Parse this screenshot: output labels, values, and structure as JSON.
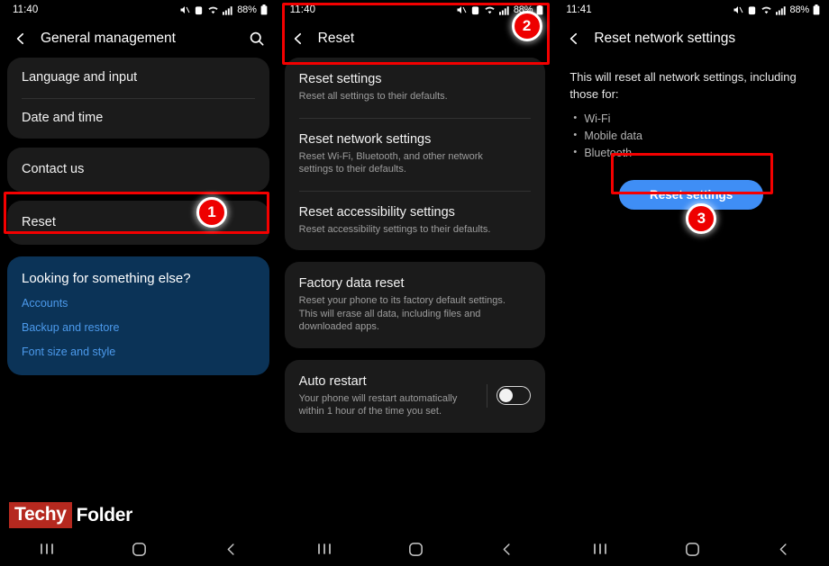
{
  "panels": [
    {
      "status": {
        "time": "11:40",
        "battery": "88%",
        "icons": [
          "mute-icon",
          "alarm-icon",
          "wifi-icon",
          "signal-icon",
          "battery-icon"
        ]
      },
      "appbar": {
        "title": "General management",
        "back": "back-icon",
        "search": "search-icon"
      },
      "cards": [
        {
          "rows": [
            {
              "title": "Language and input"
            },
            {
              "title": "Date and time"
            }
          ]
        },
        {
          "rows": [
            {
              "title": "Contact us"
            }
          ]
        },
        {
          "rows": [
            {
              "title": "Reset"
            }
          ]
        }
      ],
      "promo": {
        "title": "Looking for something else?",
        "links": [
          "Accounts",
          "Backup and restore",
          "Font size and style"
        ]
      },
      "badge": "1"
    },
    {
      "status": {
        "time": "11:40",
        "battery": "88%"
      },
      "appbar": {
        "title": "Reset",
        "back": "back-icon"
      },
      "cards": [
        {
          "rows": [
            {
              "title": "Reset settings",
              "sub": "Reset all settings to their defaults."
            },
            {
              "title": "Reset network settings",
              "sub": "Reset Wi-Fi, Bluetooth, and other network settings to their defaults."
            },
            {
              "title": "Reset accessibility settings",
              "sub": "Reset accessibility settings to their defaults."
            }
          ]
        },
        {
          "rows": [
            {
              "title": "Factory data reset",
              "sub": "Reset your phone to its factory default settings. This will erase all data, including files and downloaded apps."
            }
          ]
        },
        {
          "rows": [
            {
              "title": "Auto restart",
              "sub": "Your phone will restart automatically within 1 hour of the time you set.",
              "toggle": "off"
            }
          ]
        }
      ],
      "badge": "2"
    },
    {
      "status": {
        "time": "11:41",
        "battery": "88%"
      },
      "appbar": {
        "title": "Reset network settings",
        "back": "back-icon"
      },
      "body": {
        "description": "This will reset all network settings, including those for:",
        "bullets": [
          "Wi-Fi",
          "Mobile data",
          "Bluetooth"
        ],
        "button": "Reset settings"
      },
      "badge": "3"
    }
  ],
  "watermark": {
    "first": "Techy",
    "second": "Folder"
  },
  "navbar": {
    "recents": "recents-icon",
    "home": "home-icon",
    "back": "back-icon"
  },
  "colors": {
    "accent_blue": "#3f8ef5",
    "highlight_red": "#f40000",
    "promo_card": "#0b3357",
    "promo_link": "#4c9aec",
    "card_bg": "#1b1b1b",
    "watermark_red": "#b5291f"
  }
}
